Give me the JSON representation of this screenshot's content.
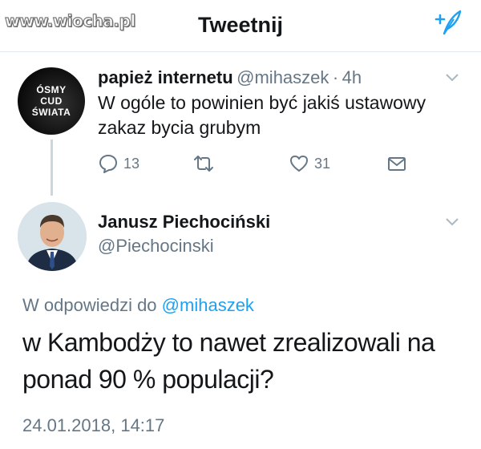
{
  "watermark": {
    "text": "www.wiocha.pl"
  },
  "header": {
    "title": "Tweetnij",
    "compose_icon": "compose-feather-icon"
  },
  "colors": {
    "accent": "#1da1f2",
    "secondary_text": "#657786",
    "primary_text": "#14171a",
    "divider": "#e1e8ed"
  },
  "tweet1": {
    "avatar_lines": [
      "ÓSMY",
      "CUD",
      "ŚWIATA"
    ],
    "name": "papież internetu",
    "handle": "@mihaszek",
    "separator": "·",
    "time": "4h",
    "text": "W ogóle to powinien być jakiś ustawowy zakaz bycia grubym",
    "actions": {
      "reply_count": "13",
      "like_count": "31"
    }
  },
  "tweet2": {
    "name": "Janusz Piechociński",
    "handle": "@Piechocinski",
    "reply_prefix": "W odpowiedzi do",
    "reply_handle": "@mihaszek",
    "text": "w Kambodży to nawet zrealizowali na ponad 90 % populacji?",
    "timestamp": "24.01.2018, 14:17"
  }
}
